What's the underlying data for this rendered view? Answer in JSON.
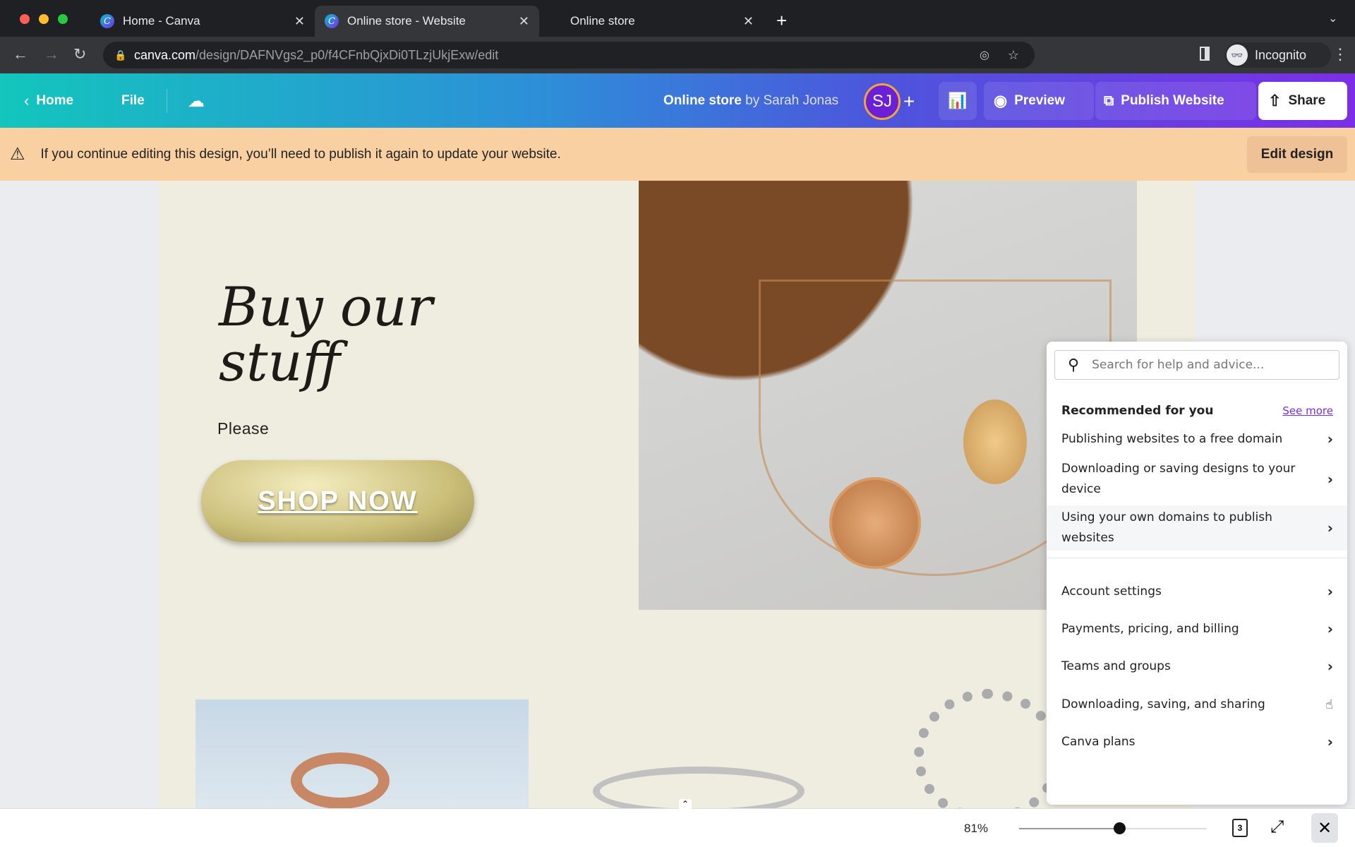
{
  "browser": {
    "tabs": [
      {
        "title": "Home - Canva"
      },
      {
        "title": "Online store - Website"
      },
      {
        "title": "Online store"
      }
    ],
    "url_domain": "canva.com",
    "url_path": "/design/DAFNVgs2_p0/f4CFnbQjxDi0TLzjUkjExw/edit",
    "profile": "Incognito"
  },
  "toolbar": {
    "home": "Home",
    "file": "File",
    "doc_title": "Online store",
    "by": "by Sarah Jonas",
    "avatar": "SJ",
    "preview": "Preview",
    "publish": "Publish Website",
    "share": "Share"
  },
  "banner": {
    "message": "If you continue editing this design, you’ll need to publish it again to update your website.",
    "edit": "Edit design"
  },
  "design": {
    "headline": "Buy our stuff",
    "body": "Please",
    "cta": "SHOP NOW"
  },
  "help": {
    "search_placeholder": "Search for help and advice...",
    "heading": "Recommended for you",
    "see_more": "See more",
    "recommended": [
      "Publishing websites to a free domain",
      "Downloading or saving designs to your device",
      "Using your own domains to publish websites"
    ],
    "topics": [
      "Account settings",
      "Payments, pricing, and billing",
      "Teams and groups",
      "Downloading, saving, and sharing",
      "Canva plans"
    ]
  },
  "footer": {
    "zoom": "81%",
    "zoom_level": 0.81,
    "pages": "3"
  },
  "colors": {
    "accent": "#7d2ae8",
    "banner": "#f9d0a2"
  }
}
